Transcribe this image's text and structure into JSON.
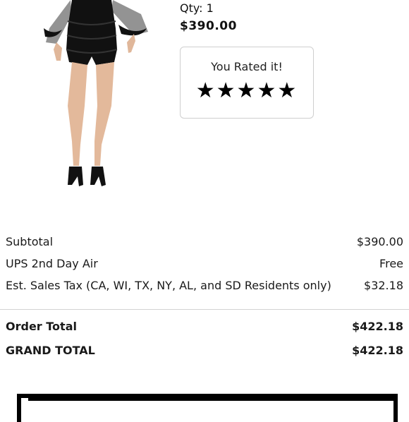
{
  "product": {
    "qty_label": "Qty: 1",
    "price": "$390.00",
    "image_icon": "lace-romper-photo"
  },
  "rating": {
    "label": "You Rated it!",
    "stars": 5,
    "max_stars": 5
  },
  "summary": {
    "rows": [
      {
        "label": "Subtotal",
        "value": "$390.00"
      },
      {
        "label": "UPS 2nd Day Air",
        "value": "Free"
      },
      {
        "label": "Est. Sales Tax (CA, WI, TX, NY, AL, and SD Residents only)",
        "value": "$32.18"
      }
    ],
    "order_total": {
      "label": "Order Total",
      "value": "$422.18"
    },
    "grand_total": {
      "label": "GRAND TOTAL",
      "value": "$422.18"
    }
  }
}
